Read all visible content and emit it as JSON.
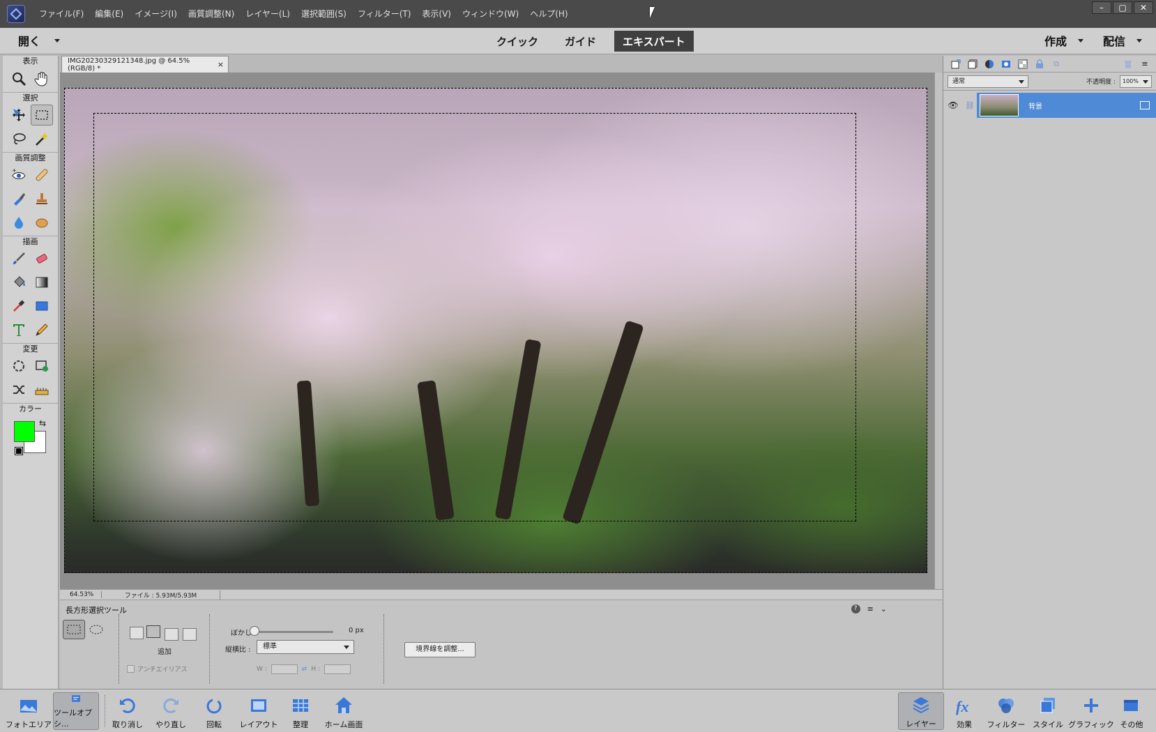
{
  "menubar": {
    "items": [
      "ファイル(F)",
      "編集(E)",
      "イメージ(I)",
      "画質調整(N)",
      "レイヤー(L)",
      "選択範囲(S)",
      "フィルター(T)",
      "表示(V)",
      "ウィンドウ(W)",
      "ヘルプ(H)"
    ],
    "window_controls": [
      "–",
      "▢",
      "✕"
    ]
  },
  "modebar": {
    "open_label": "開く",
    "tabs": [
      "クイック",
      "ガイド",
      "エキスパート"
    ],
    "active_tab": "エキスパート",
    "create_label": "作成",
    "share_label": "配信"
  },
  "toolbox": {
    "sections": [
      "表示",
      "選択",
      "画質調整",
      "描画",
      "変更",
      "カラー"
    ],
    "foreground_color": "#00ff00",
    "background_color": "#ffffff"
  },
  "document": {
    "tab_title": "IMG20230329121348.jpg @ 64.5%(RGB/8) *",
    "tab_close": "×"
  },
  "statusbar": {
    "zoom": "64.53%",
    "file_size": "ファイル : 5.93M/5.93M"
  },
  "options": {
    "title": "長方形選択ツール",
    "mode_label": "追加",
    "antialias_label": "アンチエイリアス",
    "feather_label": "ぼかし :",
    "feather_value": "0 px",
    "ratio_label": "縦横比 :",
    "ratio_value": "標準",
    "w_label": "W :",
    "h_label": "H :",
    "refine_button": "境界線を調整..."
  },
  "layers_panel": {
    "blend_mode": "通常",
    "opacity_label": "不透明度 :",
    "opacity_value": "100%",
    "layer_name": "背景"
  },
  "bottombar": {
    "left": [
      "フォトエリア",
      "ツールオプシ...",
      "取り消し",
      "やり直し",
      "回転",
      "レイアウト",
      "整理",
      "ホーム画面"
    ],
    "right": [
      "レイヤー",
      "効果",
      "フィルター",
      "スタイル",
      "グラフィック",
      "その他"
    ]
  },
  "colors": {
    "accent_selected_layer": "#4f8ad6",
    "active_tab_bg": "#3f3f3f"
  }
}
